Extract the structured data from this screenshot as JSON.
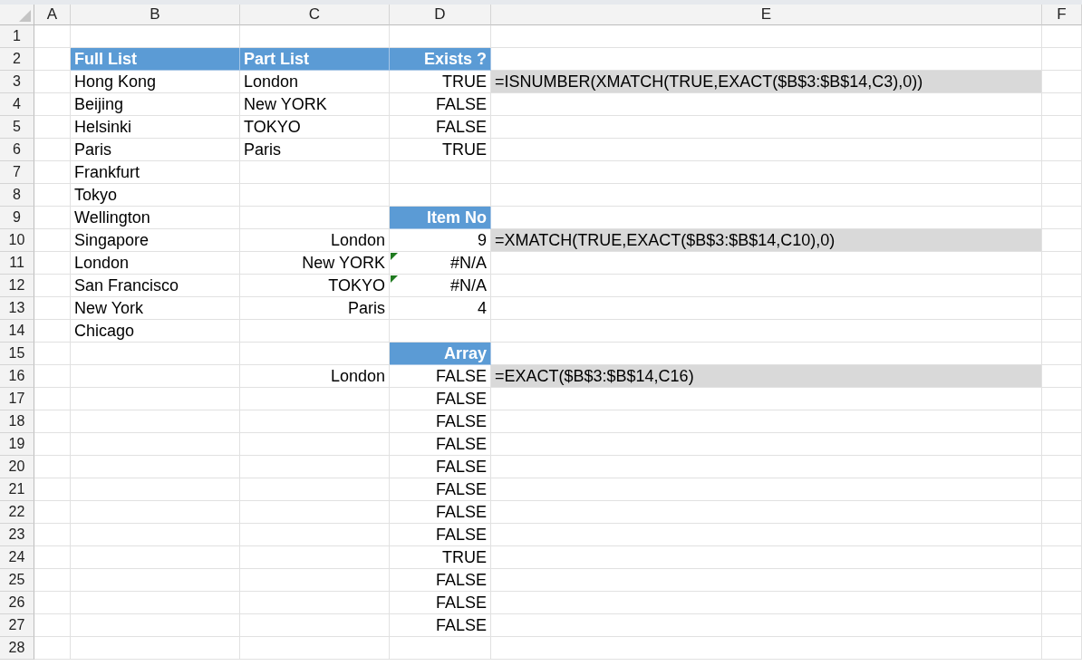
{
  "columns": [
    "A",
    "B",
    "C",
    "D",
    "E",
    "F"
  ],
  "rows": [
    {
      "number": "1",
      "cells": {}
    },
    {
      "number": "2",
      "cells": {
        "B": {
          "text": "Full List",
          "kind": "header-left"
        },
        "C": {
          "text": "Part List",
          "kind": "header-left"
        },
        "D": {
          "text": "Exists ?",
          "kind": "header-right"
        }
      }
    },
    {
      "number": "3",
      "cells": {
        "B": {
          "text": "Hong Kong",
          "kind": "label"
        },
        "C": {
          "text": "London",
          "kind": "label"
        },
        "D": {
          "text": "TRUE",
          "kind": "value"
        },
        "E": {
          "text": "=ISNUMBER(XMATCH(TRUE,EXACT($B$3:$B$14,C3),0))",
          "kind": "formula"
        }
      }
    },
    {
      "number": "4",
      "cells": {
        "B": {
          "text": "Beijing",
          "kind": "label"
        },
        "C": {
          "text": "New YORK",
          "kind": "label"
        },
        "D": {
          "text": "FALSE",
          "kind": "value"
        }
      }
    },
    {
      "number": "5",
      "cells": {
        "B": {
          "text": "Helsinki",
          "kind": "label"
        },
        "C": {
          "text": "TOKYO",
          "kind": "label"
        },
        "D": {
          "text": "FALSE",
          "kind": "value"
        }
      }
    },
    {
      "number": "6",
      "cells": {
        "B": {
          "text": "Paris",
          "kind": "label"
        },
        "C": {
          "text": "Paris",
          "kind": "label"
        },
        "D": {
          "text": "TRUE",
          "kind": "value"
        }
      }
    },
    {
      "number": "7",
      "cells": {
        "B": {
          "text": "Frankfurt",
          "kind": "label"
        }
      }
    },
    {
      "number": "8",
      "cells": {
        "B": {
          "text": "Tokyo",
          "kind": "label"
        }
      }
    },
    {
      "number": "9",
      "cells": {
        "B": {
          "text": "Wellington",
          "kind": "label"
        },
        "D": {
          "text": "Item No",
          "kind": "header-right"
        }
      }
    },
    {
      "number": "10",
      "cells": {
        "B": {
          "text": "Singapore",
          "kind": "label"
        },
        "C": {
          "text": "London",
          "kind": "value"
        },
        "D": {
          "text": "9",
          "kind": "value"
        },
        "E": {
          "text": "=XMATCH(TRUE,EXACT($B$3:$B$14,C10),0)",
          "kind": "formula"
        }
      }
    },
    {
      "number": "11",
      "cells": {
        "B": {
          "text": "London",
          "kind": "label"
        },
        "C": {
          "text": "New YORK",
          "kind": "value"
        },
        "D": {
          "text": "#N/A",
          "kind": "value",
          "error_flag": true
        }
      }
    },
    {
      "number": "12",
      "cells": {
        "B": {
          "text": "San Francisco",
          "kind": "label"
        },
        "C": {
          "text": "TOKYO",
          "kind": "value"
        },
        "D": {
          "text": "#N/A",
          "kind": "value",
          "error_flag": true
        }
      }
    },
    {
      "number": "13",
      "cells": {
        "B": {
          "text": "New York",
          "kind": "label"
        },
        "C": {
          "text": "Paris",
          "kind": "value"
        },
        "D": {
          "text": "4",
          "kind": "value"
        }
      }
    },
    {
      "number": "14",
      "cells": {
        "B": {
          "text": "Chicago",
          "kind": "label"
        }
      }
    },
    {
      "number": "15",
      "cells": {
        "D": {
          "text": "Array",
          "kind": "header-right"
        }
      }
    },
    {
      "number": "16",
      "cells": {
        "C": {
          "text": "London",
          "kind": "value"
        },
        "D": {
          "text": "FALSE",
          "kind": "value"
        },
        "E": {
          "text": "=EXACT($B$3:$B$14,C16)",
          "kind": "formula"
        }
      }
    },
    {
      "number": "17",
      "cells": {
        "D": {
          "text": "FALSE",
          "kind": "value"
        }
      }
    },
    {
      "number": "18",
      "cells": {
        "D": {
          "text": "FALSE",
          "kind": "value"
        }
      }
    },
    {
      "number": "19",
      "cells": {
        "D": {
          "text": "FALSE",
          "kind": "value"
        }
      }
    },
    {
      "number": "20",
      "cells": {
        "D": {
          "text": "FALSE",
          "kind": "value"
        }
      }
    },
    {
      "number": "21",
      "cells": {
        "D": {
          "text": "FALSE",
          "kind": "value"
        }
      }
    },
    {
      "number": "22",
      "cells": {
        "D": {
          "text": "FALSE",
          "kind": "value"
        }
      }
    },
    {
      "number": "23",
      "cells": {
        "D": {
          "text": "FALSE",
          "kind": "value"
        }
      }
    },
    {
      "number": "24",
      "cells": {
        "D": {
          "text": "TRUE",
          "kind": "value"
        }
      }
    },
    {
      "number": "25",
      "cells": {
        "D": {
          "text": "FALSE",
          "kind": "value"
        }
      }
    },
    {
      "number": "26",
      "cells": {
        "D": {
          "text": "FALSE",
          "kind": "value"
        }
      }
    },
    {
      "number": "27",
      "cells": {
        "D": {
          "text": "FALSE",
          "kind": "value"
        }
      }
    },
    {
      "number": "28",
      "cells": {}
    }
  ]
}
